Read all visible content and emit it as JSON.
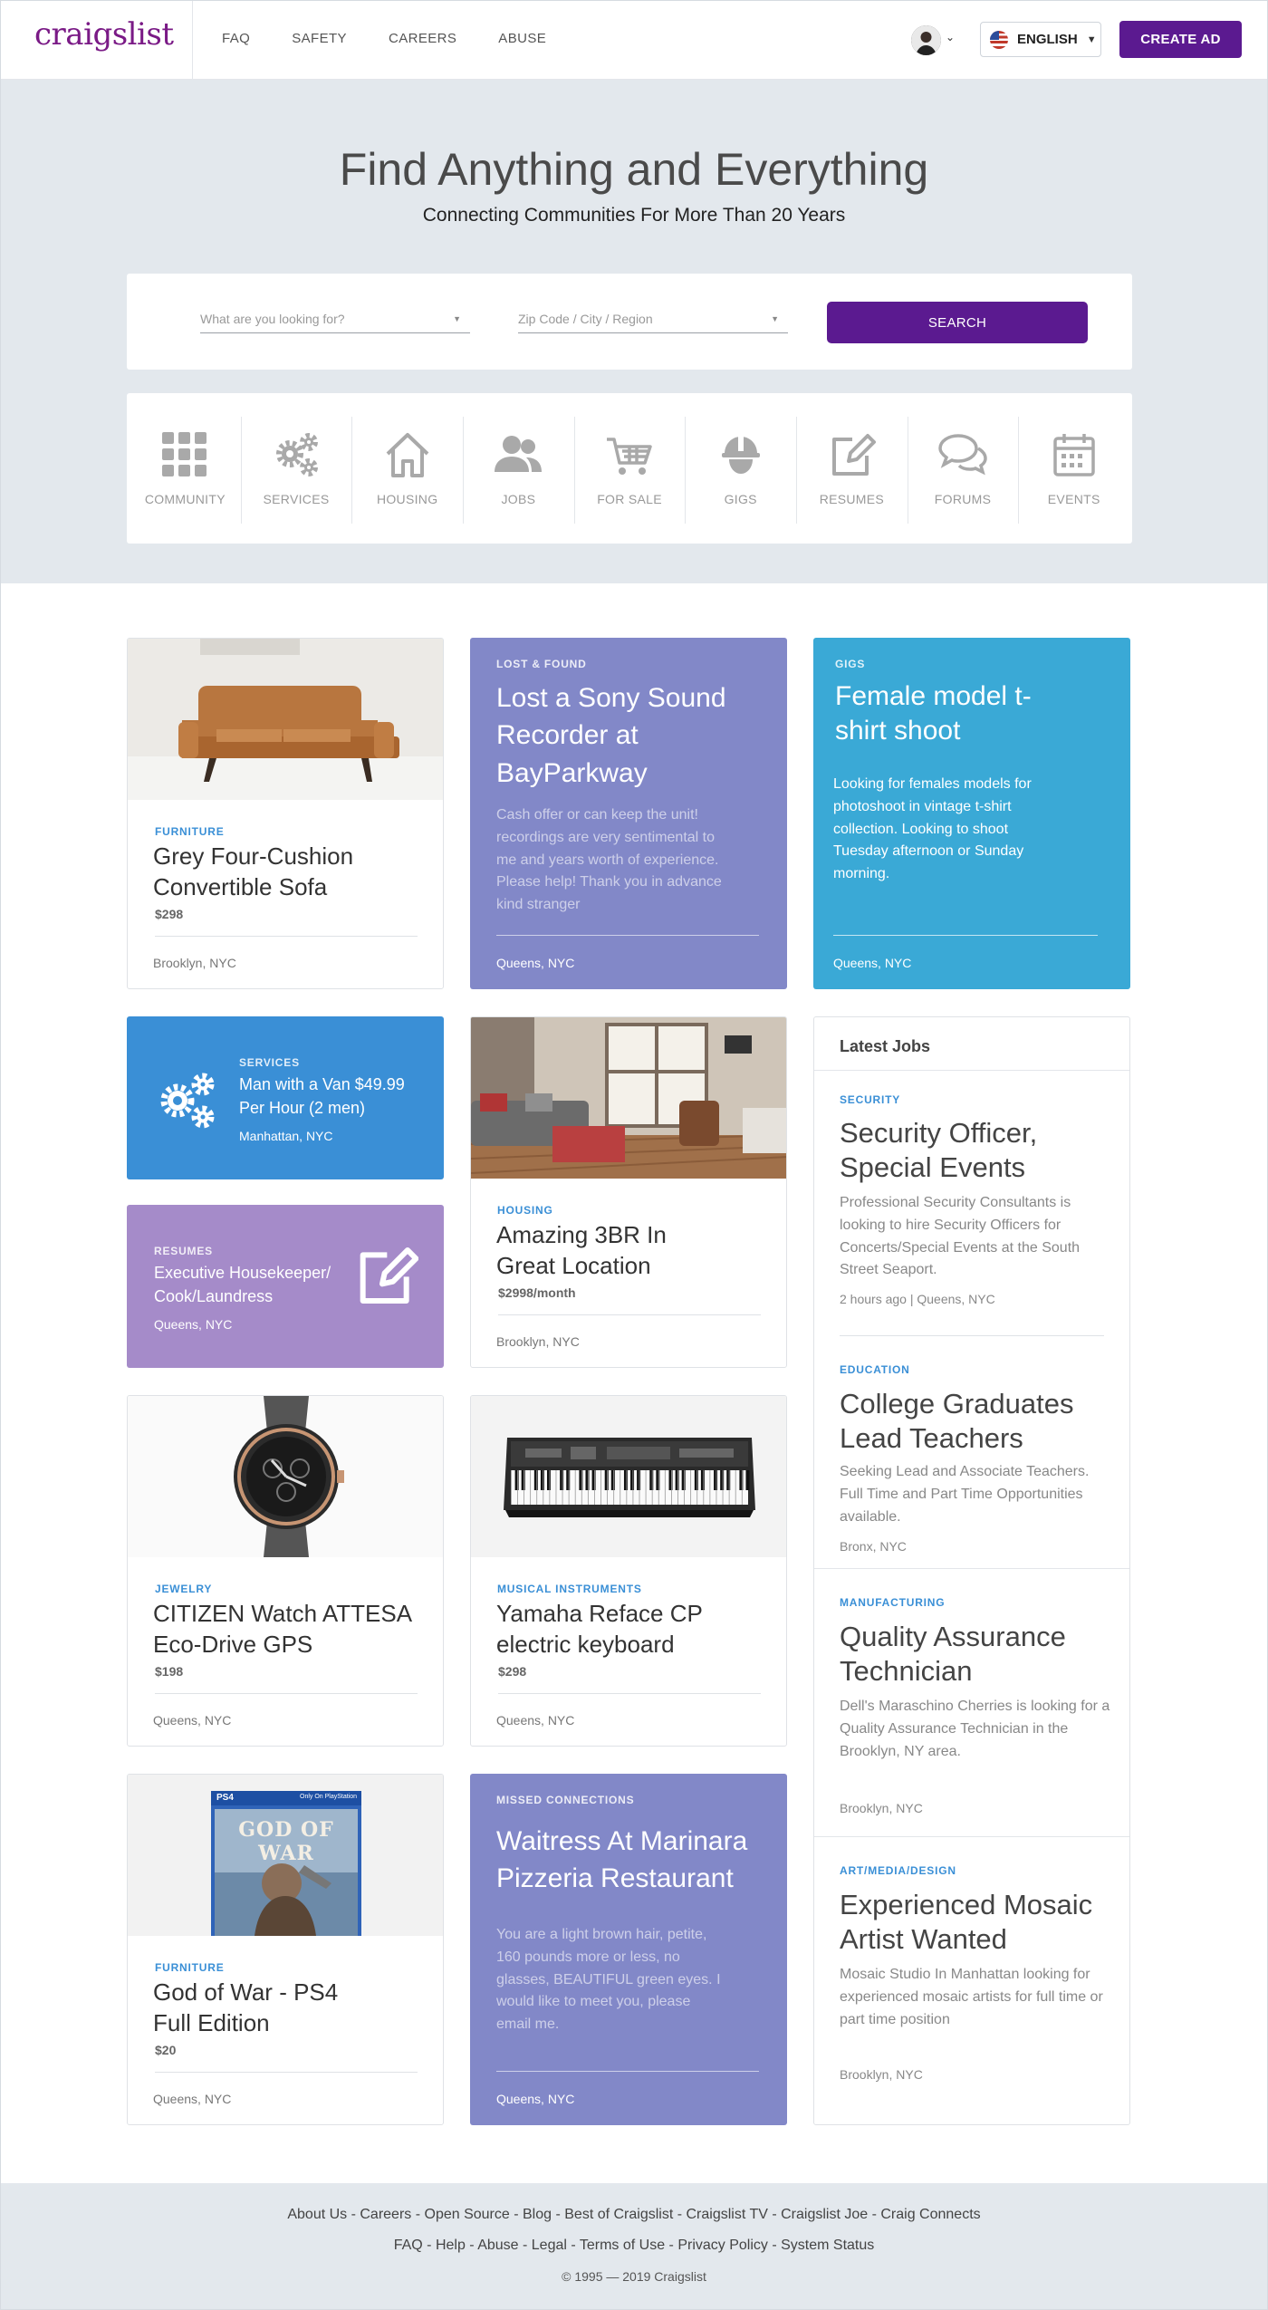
{
  "header": {
    "logo": "craigslist",
    "nav": [
      "FAQ",
      "SAFETY",
      "CAREERS",
      "ABUSE"
    ],
    "language": "ENGLISH",
    "create_ad": "CREATE AD"
  },
  "hero": {
    "title": "Find Anything and Everything",
    "subtitle": "Connecting Communities For More Than 20 Years",
    "search_placeholder": "What are you looking for?",
    "location_placeholder": "Zip Code / City / Region",
    "search_button": "SEARCH"
  },
  "categories": [
    {
      "label": "COMMUNITY",
      "icon": "grid-icon"
    },
    {
      "label": "SERVICES",
      "icon": "gears-icon"
    },
    {
      "label": "HOUSING",
      "icon": "house-icon"
    },
    {
      "label": "JOBS",
      "icon": "people-icon"
    },
    {
      "label": "FOR SALE",
      "icon": "cart-icon"
    },
    {
      "label": "GIGS",
      "icon": "hardhat-icon"
    },
    {
      "label": "RESUMES",
      "icon": "edit-icon"
    },
    {
      "label": "FORUMS",
      "icon": "chat-icon"
    },
    {
      "label": "EVENTS",
      "icon": "calendar-icon"
    }
  ],
  "listings": {
    "sofa": {
      "category": "FURNITURE",
      "title": "Grey Four-Cushion Convertible Sofa",
      "price": "$298",
      "location": "Brooklyn, NYC"
    },
    "lost": {
      "category": "LOST & FOUND",
      "title": "Lost a Sony Sound Recorder at BayParkway",
      "desc": "Cash offer or can keep the unit! recordings are very sentimental to me and years worth of experience. Please help! Thank you in advance kind stranger",
      "location": "Queens, NYC"
    },
    "gigs": {
      "category": "GIGS",
      "title": "Female model t-shirt shoot",
      "desc": "Looking for females models for photoshoot in vintage t-shirt collection. Looking to shoot Tuesday afternoon or Sunday morning.",
      "location": "Queens, NYC"
    },
    "services": {
      "category": "SERVICES",
      "title": "Man with a Van $49.99 Per Hour (2 men)",
      "location": "Manhattan, NYC"
    },
    "resumes": {
      "category": "RESUMES",
      "title": "Executive Housekeeper/ Cook/Laundress",
      "location": "Queens, NYC"
    },
    "housing": {
      "category": "HOUSING",
      "title": "Amazing 3BR In Great Location",
      "price": "$2998/month",
      "location": "Brooklyn, NYC"
    },
    "watch": {
      "category": "JEWELRY",
      "title": "CITIZEN Watch ATTESA Eco-Drive GPS",
      "price": "$198",
      "location": "Queens, NYC"
    },
    "keyboard": {
      "category": "MUSICAL INSTRUMENTS",
      "title": "Yamaha Reface CP electric keyboard",
      "price": "$298",
      "location": "Queens, NYC"
    },
    "game": {
      "category": "FURNITURE",
      "title": "God of War - PS4 Full Edition",
      "price": "$20",
      "location": "Queens, NYC",
      "box_brand": "PS4",
      "box_strip": "Only On PlayStation",
      "box_title": "GOD OF WAR"
    },
    "missed": {
      "category": "MISSED CONNECTIONS",
      "title": "Waitress At Marinara Pizzeria Restaurant",
      "desc": "You are a light brown hair, petite, 160 pounds more or less, no glasses, BEAUTIFUL green eyes. I would like to meet you, please email me.",
      "location": "Queens, NYC"
    }
  },
  "jobs": {
    "heading": "Latest Jobs",
    "items": [
      {
        "category": "SECURITY",
        "title": "Security Officer, Special Events",
        "desc": "Professional Security Consultants is looking to hire Security Officers for Concerts/Special Events at the South Street Seaport.",
        "meta": "2 hours ago | Queens, NYC"
      },
      {
        "category": "EDUCATION",
        "title": "College Graduates Lead Teachers",
        "desc": "Seeking Lead and Associate Teachers. Full Time and Part Time Opportunities available.",
        "meta": "Bronx, NYC"
      },
      {
        "category": "MANUFACTURING",
        "title": "Quality Assurance Technician",
        "desc": "Dell's Maraschino Cherries is looking for a Quality Assurance Technician in the Brooklyn, NY area.",
        "meta": "Brooklyn, NYC"
      },
      {
        "category": "ART/MEDIA/DESIGN",
        "title": "Experienced Mosaic Artist Wanted",
        "desc": "Mosaic Studio In Manhattan looking for experienced mosaic artists for full time or part time position",
        "meta": "Brooklyn, NYC"
      }
    ]
  },
  "footer": {
    "links1": "About Us - Careers - Open Source - Blog - Best of Craigslist - Craigslist TV - Craigslist Joe - Craig Connects",
    "links2": "FAQ - Help - Abuse - Legal - Terms of Use - Privacy Policy - System Status",
    "copyright": "© 1995 — 2019 Craigslist"
  },
  "colors": {
    "brand": "#5b1a90",
    "lavender": "#8288c8",
    "cyan": "#3aa9d6",
    "blue": "#3a8fd6",
    "purple": "#a58bc9"
  }
}
